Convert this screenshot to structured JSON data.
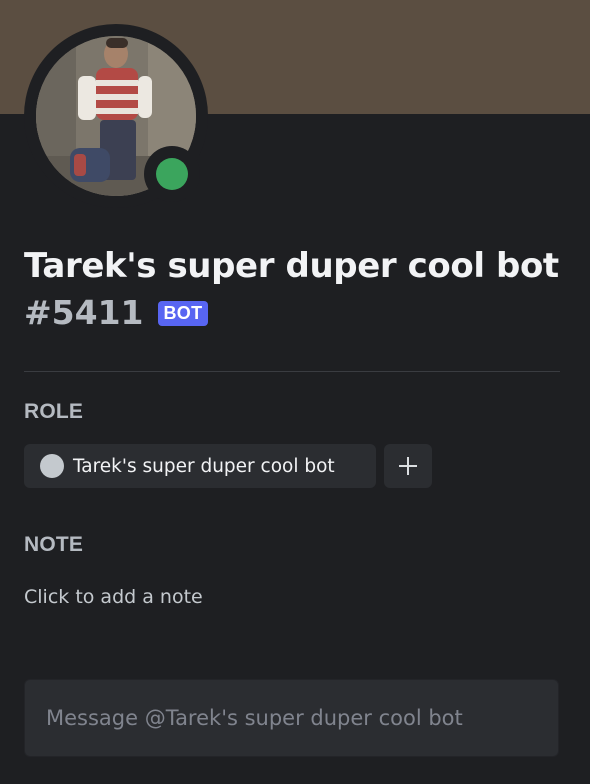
{
  "profile": {
    "username": "Tarek's super duper cool bot",
    "discriminator": "#5411",
    "bot_badge": "BOT",
    "avatar_icon": "avatar-photo",
    "status": "online",
    "status_color": "#3ba55d",
    "banner_color": "#5b4e41"
  },
  "roles": {
    "label": "ROLE",
    "items": [
      {
        "name": "Tarek's super duper cool bot",
        "color": "#c4c9ce"
      }
    ],
    "add_icon": "plus-icon"
  },
  "note": {
    "label": "NOTE",
    "placeholder": "Click to add a note"
  },
  "message": {
    "placeholder": "Message @Tarek's super duper cool bot",
    "value": ""
  }
}
